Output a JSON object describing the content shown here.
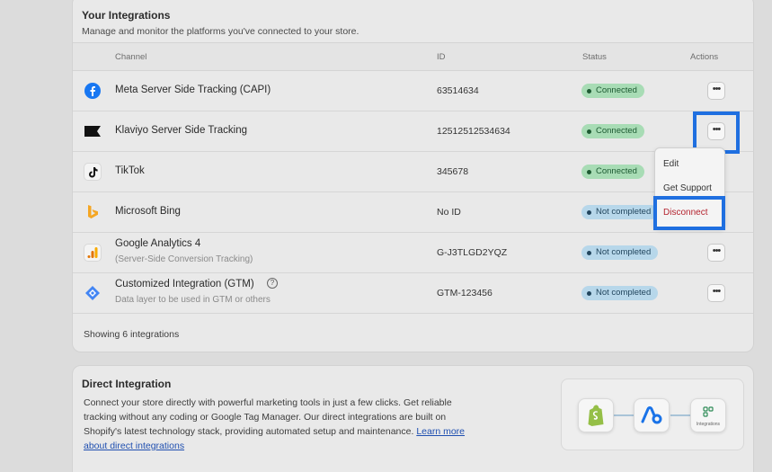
{
  "integrations": {
    "title": "Your Integrations",
    "subtitle": "Manage and monitor the platforms you've connected to your store.",
    "columns": {
      "channel": "Channel",
      "id": "ID",
      "status": "Status",
      "actions": "Actions"
    },
    "rows": [
      {
        "name": "Meta Server Side Tracking (CAPI)",
        "sub": "",
        "id": "63514634",
        "status": "Connected",
        "icon": "facebook-icon"
      },
      {
        "name": "Klaviyo Server Side Tracking",
        "sub": "",
        "id": "12512512534634",
        "status": "Connected",
        "icon": "klaviyo-icon"
      },
      {
        "name": "TikTok",
        "sub": "",
        "id": "345678",
        "status": "Connected",
        "icon": "tiktok-icon"
      },
      {
        "name": "Microsoft Bing",
        "sub": "",
        "id": "No ID",
        "status": "Not completed",
        "icon": "bing-icon"
      },
      {
        "name": "Google Analytics 4",
        "sub": "(Server-Side Conversion Tracking)",
        "id": "G-J3TLGD2YQZ",
        "status": "Not completed",
        "icon": "google-analytics-icon"
      },
      {
        "name": "Customized Integration (GTM)",
        "sub": "Data layer to be used in GTM or others",
        "id": "GTM-123456",
        "status": "Not completed",
        "icon": "gtm-icon"
      }
    ],
    "footer": "Showing 6 integrations",
    "action_menu": {
      "edit": "Edit",
      "support": "Get Support",
      "disconnect": "Disconnect"
    },
    "colors": {
      "connected": "#a8dcb5",
      "not_completed": "#b7d7ea",
      "highlight": "#1f6fe0",
      "danger": "#b4232e"
    }
  },
  "direct": {
    "title": "Direct Integration",
    "body": "Connect your store directly with powerful marketing tools in just a few clicks. Get reliable tracking without any coding or Google Tag Manager. Our direct integrations are built on Shopify's latest technology stack, providing automated setup and maintenance. ",
    "link": "Learn more about direct integrations",
    "diagram_label": "Integrations",
    "icons": [
      "shopify-icon",
      "app-logo-icon",
      "integrations-icon"
    ]
  }
}
